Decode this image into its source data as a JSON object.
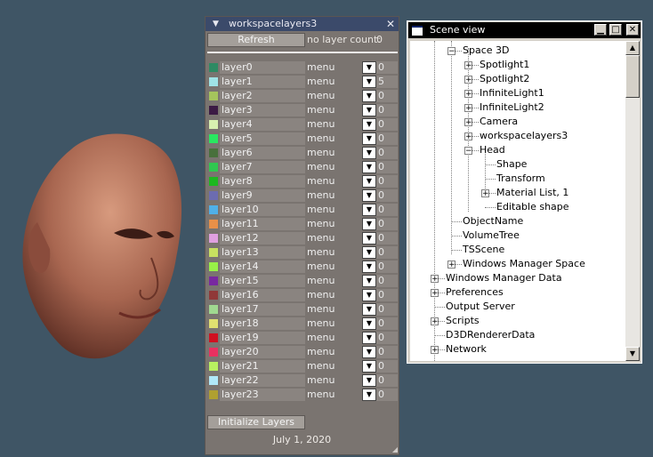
{
  "layers_panel": {
    "title": "workspacelayers3",
    "close_glyph": "✕",
    "refresh_label": "Refresh",
    "count_label": "no layer count:",
    "count_value": "0",
    "layers": [
      {
        "name": "layer0",
        "menu": "menu",
        "value": "0",
        "color": "#2e8a63"
      },
      {
        "name": "layer1",
        "menu": "menu",
        "value": "5",
        "color": "#9fe3e6"
      },
      {
        "name": "layer2",
        "menu": "menu",
        "value": "0",
        "color": "#a5c45c"
      },
      {
        "name": "layer3",
        "menu": "menu",
        "value": "0",
        "color": "#3b1a44"
      },
      {
        "name": "layer4",
        "menu": "menu",
        "value": "0",
        "color": "#d8f0b0"
      },
      {
        "name": "layer5",
        "menu": "menu",
        "value": "0",
        "color": "#29e860"
      },
      {
        "name": "layer6",
        "menu": "menu",
        "value": "0",
        "color": "#48703c"
      },
      {
        "name": "layer7",
        "menu": "menu",
        "value": "0",
        "color": "#30c850"
      },
      {
        "name": "layer8",
        "menu": "menu",
        "value": "0",
        "color": "#1cb820"
      },
      {
        "name": "layer9",
        "menu": "menu",
        "value": "0",
        "color": "#6c6cb0"
      },
      {
        "name": "layer10",
        "menu": "menu",
        "value": "0",
        "color": "#50b0e8"
      },
      {
        "name": "layer11",
        "menu": "menu",
        "value": "0",
        "color": "#e89048"
      },
      {
        "name": "layer12",
        "menu": "menu",
        "value": "0",
        "color": "#e0a0e0"
      },
      {
        "name": "layer13",
        "menu": "menu",
        "value": "0",
        "color": "#c8e060"
      },
      {
        "name": "layer14",
        "menu": "menu",
        "value": "0",
        "color": "#98f048"
      },
      {
        "name": "layer15",
        "menu": "menu",
        "value": "0",
        "color": "#7828a0"
      },
      {
        "name": "layer16",
        "menu": "menu",
        "value": "0",
        "color": "#903838"
      },
      {
        "name": "layer17",
        "menu": "menu",
        "value": "0",
        "color": "#a0d890"
      },
      {
        "name": "layer18",
        "menu": "menu",
        "value": "0",
        "color": "#e0e070"
      },
      {
        "name": "layer19",
        "menu": "menu",
        "value": "0",
        "color": "#d01020"
      },
      {
        "name": "layer20",
        "menu": "menu",
        "value": "0",
        "color": "#e83060"
      },
      {
        "name": "layer21",
        "menu": "menu",
        "value": "0",
        "color": "#b8f060"
      },
      {
        "name": "layer22",
        "menu": "menu",
        "value": "0",
        "color": "#b0e8f8"
      },
      {
        "name": "layer23",
        "menu": "menu",
        "value": "0",
        "color": "#b0a030"
      }
    ],
    "init_label": "Initialize Layers",
    "date": "July 1, 2020"
  },
  "scene_view": {
    "title": "Scene view",
    "tree": [
      {
        "label": "Space 3D",
        "level": 2,
        "toggle": "−"
      },
      {
        "label": "Spotlight1",
        "level": 3,
        "toggle": "+"
      },
      {
        "label": "Spotlight2",
        "level": 3,
        "toggle": "+"
      },
      {
        "label": "InfiniteLight1",
        "level": 3,
        "toggle": "+"
      },
      {
        "label": "InfiniteLight2",
        "level": 3,
        "toggle": "+"
      },
      {
        "label": "Camera",
        "level": 3,
        "toggle": "+"
      },
      {
        "label": "workspacelayers3",
        "level": 3,
        "toggle": "+"
      },
      {
        "label": "Head",
        "level": 3,
        "toggle": "−"
      },
      {
        "label": "Shape",
        "level": 4,
        "toggle": ""
      },
      {
        "label": "Transform",
        "level": 4,
        "toggle": ""
      },
      {
        "label": "Material List, 1",
        "level": 4,
        "toggle": "+"
      },
      {
        "label": "Editable shape",
        "level": 4,
        "toggle": ""
      },
      {
        "label": "ObjectName",
        "level": 2,
        "toggle": ""
      },
      {
        "label": "VolumeTree",
        "level": 2,
        "toggle": ""
      },
      {
        "label": "TSScene",
        "level": 2,
        "toggle": ""
      },
      {
        "label": "Windows Manager Space",
        "level": 2,
        "toggle": "+"
      },
      {
        "label": "Windows Manager Data",
        "level": 1,
        "toggle": "+"
      },
      {
        "label": "Preferences",
        "level": 1,
        "toggle": "+"
      },
      {
        "label": "Output Server",
        "level": 1,
        "toggle": ""
      },
      {
        "label": "Scripts",
        "level": 1,
        "toggle": "+"
      },
      {
        "label": "D3DRendererData",
        "level": 1,
        "toggle": ""
      },
      {
        "label": "Network",
        "level": 1,
        "toggle": "+"
      }
    ]
  }
}
